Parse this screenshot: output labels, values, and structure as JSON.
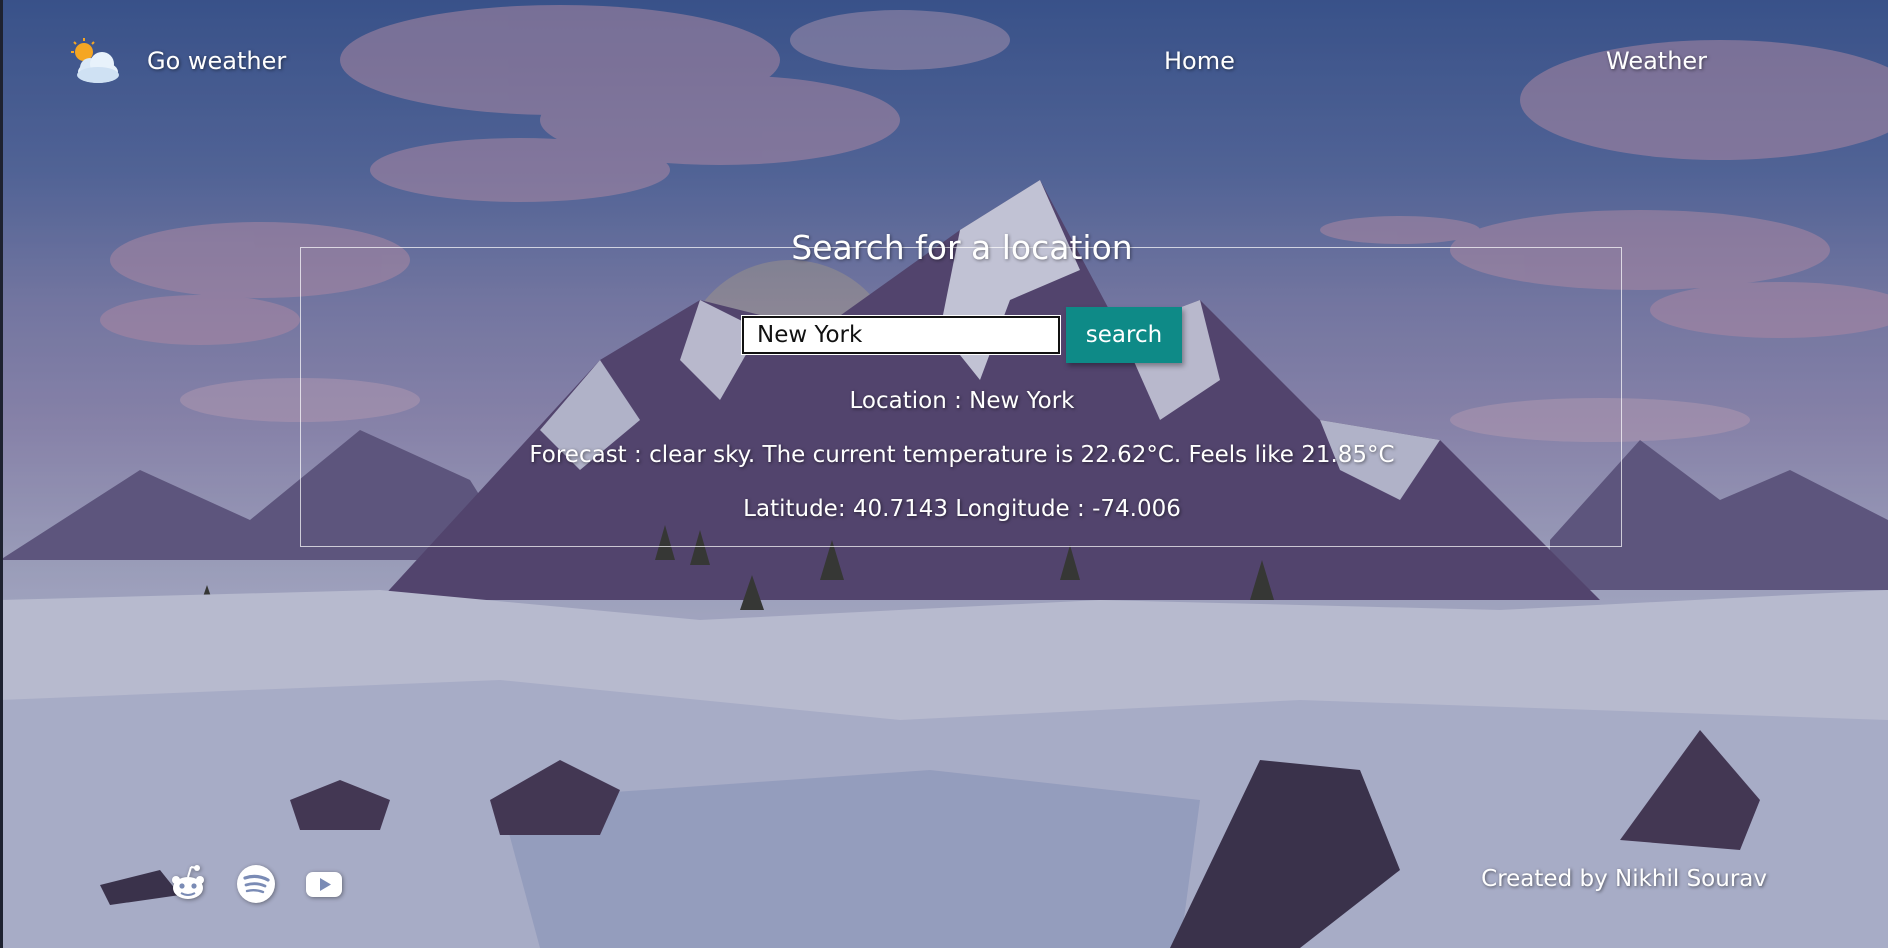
{
  "navbar": {
    "brand_label": "Go weather",
    "brand_icon": "partly-cloudy-icon",
    "links": [
      {
        "label": "Home"
      },
      {
        "label": "Weather"
      }
    ]
  },
  "search": {
    "legend": "Search for a location",
    "input_value": "New York",
    "button_label": "search",
    "button_color": "#0e8a87"
  },
  "result": {
    "location": "Location : New York",
    "forecast": "Forecast : clear sky. The current temperature is 22.62°C. Feels like 21.85°C",
    "coords": "Latitude: 40.7143 Longitude : -74.006"
  },
  "footer": {
    "social": [
      {
        "icon": "reddit-icon"
      },
      {
        "icon": "spotify-icon"
      },
      {
        "icon": "youtube-icon"
      }
    ],
    "credit": "Created by Nikhil Sourav"
  }
}
